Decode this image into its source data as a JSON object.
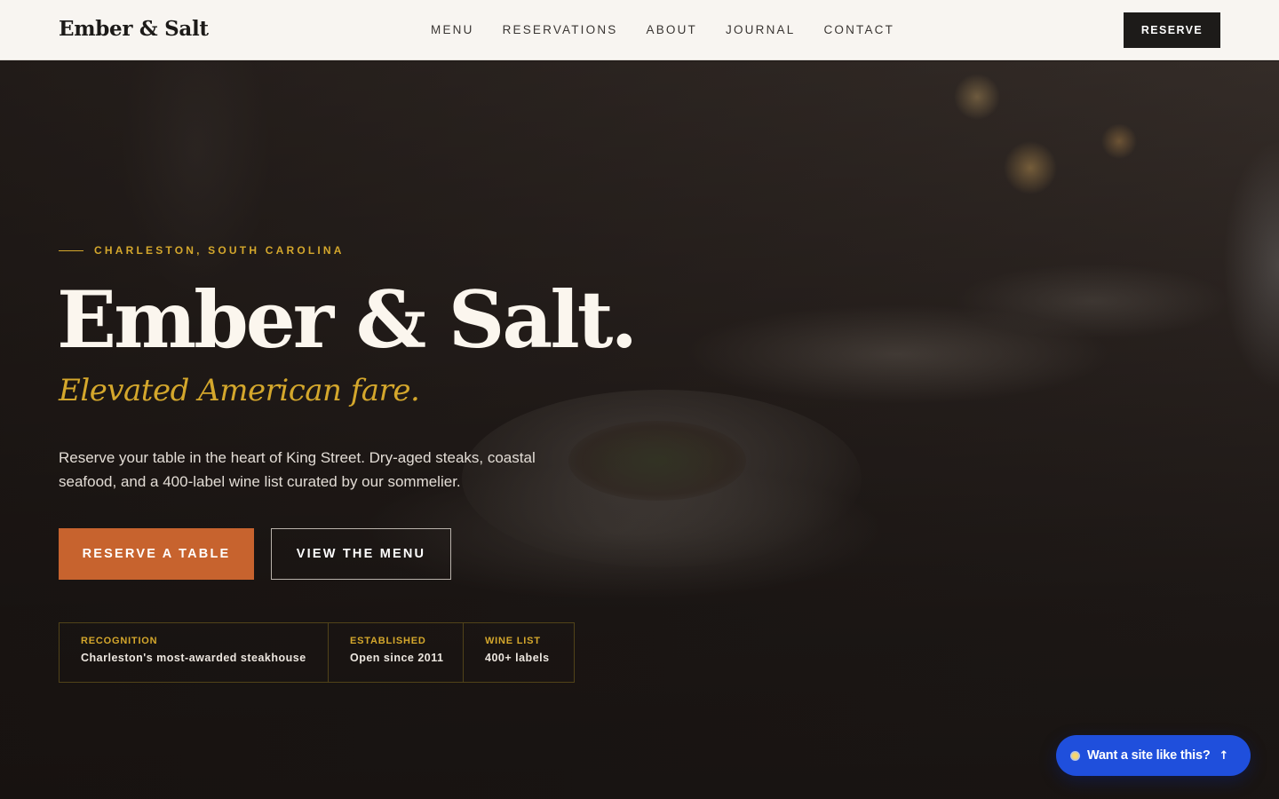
{
  "header": {
    "logo": "Ember & Salt",
    "nav": [
      "MENU",
      "RESERVATIONS",
      "ABOUT",
      "JOURNAL",
      "CONTACT"
    ],
    "reserve_label": "RESERVE"
  },
  "hero": {
    "eyebrow": "CHARLESTON, SOUTH CAROLINA",
    "title": "Ember & Salt.",
    "subtitle": "Elevated American fare.",
    "description": "Reserve your table in the heart of King Street. Dry-aged steaks, coastal seafood, and a 400-label wine list curated by our sommelier.",
    "primary_button": "RESERVE A TABLE",
    "secondary_button": "VIEW THE MENU",
    "stats": [
      {
        "label": "RECOGNITION",
        "value": "Charleston's most-awarded steakhouse"
      },
      {
        "label": "ESTABLISHED",
        "value": "Open since 2011"
      },
      {
        "label": "WINE LIST",
        "value": "400+ labels"
      }
    ]
  },
  "floating_cta": {
    "label": "Want a site like this?",
    "icon": "arrow-up-icon"
  },
  "colors": {
    "accent_gold": "#d4a72c",
    "accent_copper": "#c7632e",
    "cta_blue": "#1f4fdc",
    "header_bg": "#f8f5f1"
  }
}
